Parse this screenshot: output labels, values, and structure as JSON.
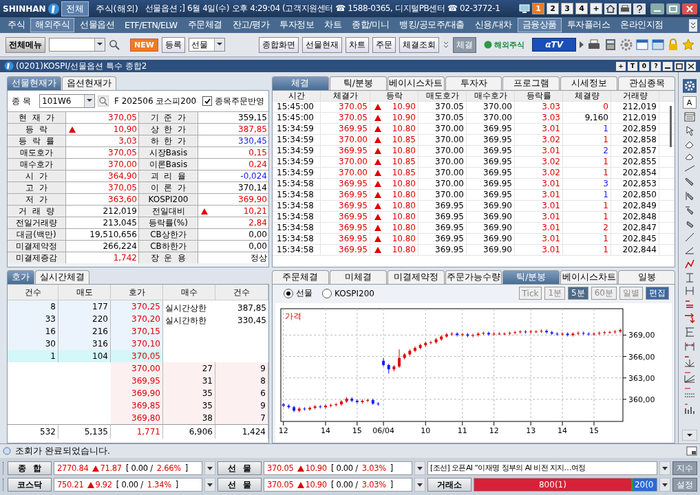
{
  "top_bar": {
    "logo": "SHINHAN",
    "tabs": [
      {
        "label": "전체",
        "selected": true
      },
      {
        "label": "주식(해외)",
        "selected": false
      }
    ],
    "info": "선물옵션 ;] 6월 4일(수) 오후 4:29:04 (고객지원센터 ☎ 1588-0365, 디지털PB센터 ☎ 02-3772-1",
    "screens": [
      {
        "label": "1",
        "selected": true
      },
      {
        "label": "2",
        "selected": false
      },
      {
        "label": "3",
        "selected": false
      },
      {
        "label": "4",
        "selected": false
      },
      {
        "label": "+",
        "selected": false
      }
    ]
  },
  "menu": [
    {
      "label": "주식",
      "selected": false
    },
    {
      "label": "해외주식",
      "selected": true
    },
    {
      "label": "선물옵션",
      "selected": false
    },
    {
      "label": "ETF/ETN/ELW",
      "selected": false
    },
    {
      "label": "주문체결",
      "selected": false
    },
    {
      "label": "잔고/평가",
      "selected": false
    },
    {
      "label": "투자정보",
      "selected": false
    },
    {
      "label": "차트",
      "selected": false
    },
    {
      "label": "종합/미니",
      "selected": false
    },
    {
      "label": "뱅킹/공모주/대출",
      "selected": false
    },
    {
      "label": "신용/대차",
      "selected": false
    },
    {
      "label": "금융상품",
      "selected": true
    },
    {
      "label": "투자플러스",
      "selected": false
    },
    {
      "label": "온라인지점",
      "selected": false
    }
  ],
  "toolbar": {
    "all_menu": "전체메뉴",
    "new_badge": "NEW",
    "register": "등록",
    "category": "선물",
    "screens": [
      "종합화면",
      "선물현재",
      "차트",
      "주문",
      "체결조회"
    ],
    "fill": "체결",
    "overseas": "해외주식",
    "tv": "αTV"
  },
  "window": {
    "title": "(0201)KOSPI/선물옵션 특수 종합2",
    "buttons": [
      "+",
      "T",
      "0",
      "?"
    ]
  },
  "quote": {
    "tabs": [
      {
        "label": "선물현재가",
        "selected": true
      },
      {
        "label": "옵션현재가",
        "selected": false
      }
    ],
    "symbol_label": "종 목",
    "code": "101W6",
    "name": "F 202506 코스피200",
    "order_link": {
      "label": "종목주문반영",
      "checked": true
    },
    "rows": [
      {
        "left": {
          "label": "현 재 가",
          "value": "370,05",
          "color": "#e00000",
          "arrow": false
        },
        "right": {
          "label": "기 준 가",
          "value": "359,15",
          "color": "#000000",
          "arrow": false
        }
      },
      {
        "left": {
          "label": "등 락",
          "value": "10,90",
          "color": "#e00000",
          "arrow": true
        },
        "right": {
          "label": "상 한 가",
          "value": "387,85",
          "color": "#e00000",
          "arrow": false
        }
      },
      {
        "left": {
          "label": "등 락 률",
          "value": "3,03",
          "color": "#e00000",
          "arrow": false
        },
        "right": {
          "label": "하 한 가",
          "value": "330,45",
          "color": "#1a1aff",
          "arrow": false
        }
      },
      {
        "left": {
          "label": "매도호가",
          "value": "370,05",
          "color": "#e00000",
          "arrow": false
        },
        "right": {
          "label": "시장Basis",
          "value": "0,15",
          "color": "#e00000",
          "arrow": false
        }
      },
      {
        "left": {
          "label": "매수호가",
          "value": "370,00",
          "color": "#e00000",
          "arrow": false
        },
        "right": {
          "label": "이론Basis",
          "value": "0,24",
          "color": "#e00000",
          "arrow": false
        }
      },
      {
        "left": {
          "label": "시 가",
          "value": "364,90",
          "color": "#e00000",
          "arrow": false
        },
        "right": {
          "label": "괴 리 율",
          "value": "-0,024",
          "color": "#1a1aff",
          "arrow": false
        }
      },
      {
        "left": {
          "label": "고 가",
          "value": "370,05",
          "color": "#e00000",
          "arrow": false
        },
        "right": {
          "label": "이 론 가",
          "value": "370,14",
          "color": "#000000",
          "arrow": false
        }
      },
      {
        "left": {
          "label": "저 가",
          "value": "363,60",
          "color": "#e00000",
          "arrow": false
        },
        "right": {
          "label": "KOSPI200",
          "value": "369,90",
          "color": "#e00000",
          "arrow": false
        }
      },
      {
        "left": {
          "label": "거 래 량",
          "value": "212,019",
          "color": "#000000",
          "arrow": false
        },
        "right": {
          "label": "전일대비",
          "value": "10,21",
          "color": "#e00000",
          "arrow": true
        }
      },
      {
        "left": {
          "label": "전일거래량",
          "value": "213,045",
          "color": "#000000",
          "arrow": false
        },
        "right": {
          "label": "등락률(%)",
          "value": "2,84",
          "color": "#e00000",
          "arrow": false
        }
      },
      {
        "left": {
          "label": "대금(백만)",
          "value": "19,510,656",
          "color": "#000000",
          "arrow": false
        },
        "right": {
          "label": "CB상한가",
          "value": "0,00",
          "color": "#000000",
          "arrow": false
        }
      },
      {
        "left": {
          "label": "미결제약정",
          "value": "266,224",
          "color": "#000000",
          "arrow": false
        },
        "right": {
          "label": "CB하한가",
          "value": "0,00",
          "color": "#000000",
          "arrow": false
        }
      },
      {
        "left": {
          "label": "미결제증감",
          "value": "1,742",
          "color": "#e00000",
          "arrow": false
        },
        "right": {
          "label": "장 운 용",
          "value": "정상",
          "arrow": false
        }
      }
    ]
  },
  "trades": {
    "tabs": [
      {
        "label": "체결",
        "selected": true
      },
      {
        "label": "틱/분봉",
        "selected": false
      },
      {
        "label": "베이시스차트",
        "selected": false
      },
      {
        "label": "투자자",
        "selected": false
      },
      {
        "label": "프로그램",
        "selected": false
      },
      {
        "label": "시세정보",
        "selected": false
      },
      {
        "label": "관심종목",
        "selected": false
      }
    ],
    "columns": [
      "시간",
      "체결가",
      "등락",
      "매도호가",
      "매수호가",
      "등락률",
      "체결량",
      "거래량"
    ],
    "rows": [
      {
        "time": "15:45:00",
        "price": "370.05",
        "change": "10.90",
        "ask": "370.05",
        "bid": "370.00",
        "rate": "3.03",
        "color": "#e00000",
        "qty": {
          "text": "0",
          "color": "#e00000"
        },
        "volume": "212,019"
      },
      {
        "time": "15:45:00",
        "price": "370.05",
        "change": "10.90",
        "ask": "370.05",
        "bid": "370.00",
        "rate": "3.03",
        "color": "#e00000",
        "qty": {
          "text": "9,160",
          "color": "#000000"
        },
        "volume": "212,019"
      },
      {
        "time": "15:34:59",
        "price": "369.95",
        "change": "10.80",
        "ask": "370.00",
        "bid": "369.95",
        "rate": "3.01",
        "color": "#e00000",
        "qty": {
          "text": "1",
          "color": "#1a1aff"
        },
        "volume": "202,859"
      },
      {
        "time": "15:34:59",
        "price": "370.00",
        "change": "10.85",
        "ask": "370.00",
        "bid": "369.95",
        "rate": "3.02",
        "color": "#e00000",
        "qty": {
          "text": "1",
          "color": "#e00000"
        },
        "volume": "202,858"
      },
      {
        "time": "15:34:59",
        "price": "369.95",
        "change": "10.80",
        "ask": "370.00",
        "bid": "369.95",
        "rate": "3.01",
        "color": "#e00000",
        "qty": {
          "text": "2",
          "color": "#1a1aff"
        },
        "volume": "202,857"
      },
      {
        "time": "15:34:59",
        "price": "370.00",
        "change": "10.85",
        "ask": "370.00",
        "bid": "369.95",
        "rate": "3.02",
        "color": "#e00000",
        "qty": {
          "text": "1",
          "color": "#e00000"
        },
        "volume": "202,855"
      },
      {
        "time": "15:34:59",
        "price": "370.00",
        "change": "10.85",
        "ask": "370.00",
        "bid": "369.95",
        "rate": "3.02",
        "color": "#e00000",
        "qty": {
          "text": "1",
          "color": "#e00000"
        },
        "volume": "202,854"
      },
      {
        "time": "15:34:58",
        "price": "369.95",
        "change": "10.80",
        "ask": "370.00",
        "bid": "369.95",
        "rate": "3.01",
        "color": "#e00000",
        "qty": {
          "text": "3",
          "color": "#1a1aff"
        },
        "volume": "202,853"
      },
      {
        "time": "15:34:58",
        "price": "369.95",
        "change": "10.80",
        "ask": "370.00",
        "bid": "369.95",
        "rate": "3.01",
        "color": "#e00000",
        "qty": {
          "text": "1",
          "color": "#1a1aff"
        },
        "volume": "202,850"
      },
      {
        "time": "15:34:58",
        "price": "369.95",
        "change": "10.80",
        "ask": "369.95",
        "bid": "369.90",
        "rate": "3.01",
        "color": "#e00000",
        "qty": {
          "text": "1",
          "color": "#e00000"
        },
        "volume": "202,849"
      },
      {
        "time": "15:34:58",
        "price": "369.95",
        "change": "10.80",
        "ask": "369.95",
        "bid": "369.90",
        "rate": "3.01",
        "color": "#e00000",
        "qty": {
          "text": "1",
          "color": "#e00000"
        },
        "volume": "202,848"
      },
      {
        "time": "15:34:58",
        "price": "369.95",
        "change": "10.80",
        "ask": "369.95",
        "bid": "369.90",
        "rate": "3.01",
        "color": "#e00000",
        "qty": {
          "text": "2",
          "color": "#e00000"
        },
        "volume": "202,847"
      },
      {
        "time": "15:34:58",
        "price": "369.95",
        "change": "10.80",
        "ask": "369.95",
        "bid": "369.90",
        "rate": "3.01",
        "color": "#e00000",
        "qty": {
          "text": "1",
          "color": "#e00000"
        },
        "volume": "202,845"
      },
      {
        "time": "15:34:58",
        "price": "369.95",
        "change": "10.80",
        "ask": "369.95",
        "bid": "369.90",
        "rate": "3.01",
        "color": "#e00000",
        "qty": {
          "text": "1",
          "color": "#e00000"
        },
        "volume": "202,844"
      }
    ]
  },
  "side_tools": {
    "font_button": "A"
  },
  "orderbook": {
    "tabs": [
      {
        "label": "호가",
        "selected": true
      },
      {
        "label": "실시간체결",
        "selected": false
      }
    ],
    "columns": [
      "건수",
      "매도",
      "호가",
      "매수",
      "건수"
    ],
    "asks": [
      {
        "count": "8",
        "qty": "177",
        "price": "370,25",
        "best": false
      },
      {
        "count": "33",
        "qty": "220",
        "price": "370,20",
        "best": false
      },
      {
        "count": "16",
        "qty": "216",
        "price": "370,15",
        "best": false
      },
      {
        "count": "30",
        "qty": "316",
        "price": "370,10",
        "best": false
      },
      {
        "count": "1",
        "qty": "104",
        "price": "370,05",
        "best": true
      }
    ],
    "limits": [
      {
        "label": "실시간상한",
        "value": "387,85"
      },
      {
        "label": "실시간하한",
        "value": "330,45"
      }
    ],
    "bids": [
      {
        "price": "370,00",
        "qty": "27",
        "count": "9"
      },
      {
        "price": "369,95",
        "qty": "31",
        "count": "8"
      },
      {
        "price": "369,90",
        "qty": "35",
        "count": "6"
      },
      {
        "price": "369,85",
        "qty": "35",
        "count": "9"
      },
      {
        "price": "369,80",
        "qty": "38",
        "count": "7"
      }
    ],
    "totals": [
      "532",
      "5,135",
      "1,771",
      "6,906",
      "1,424"
    ]
  },
  "orders": {
    "tabs": [
      {
        "label": "주문체결",
        "selected": false
      },
      {
        "label": "미체결",
        "selected": false
      },
      {
        "label": "미결제약정",
        "selected": false
      },
      {
        "label": "주문가능수량",
        "selected": false
      },
      {
        "label": "틱/분봉",
        "selected": true
      },
      {
        "label": "베이시스차트",
        "selected": false
      },
      {
        "label": "일봉",
        "selected": false
      }
    ],
    "radios": [
      {
        "label": "선물",
        "selected": true
      },
      {
        "label": "KOSPI200",
        "selected": false
      }
    ],
    "periods": [
      {
        "label": "Tick",
        "selected": false,
        "disabled": true
      },
      {
        "label": "1분",
        "selected": false,
        "disabled": true
      },
      {
        "label": "5분",
        "selected": true,
        "disabled": false
      },
      {
        "label": "60분",
        "selected": false,
        "disabled": true
      },
      {
        "label": "일별",
        "selected": false,
        "disabled": true
      }
    ],
    "edit": "편집",
    "chart_data": {
      "type": "candlestick",
      "title": "가격",
      "grid": true,
      "ylim": [
        356.9,
        372.7
      ],
      "yticks": [
        {
          "value": 360,
          "label": "360,00"
        },
        {
          "value": 363,
          "label": "363,00"
        },
        {
          "value": 366,
          "label": "366,00"
        },
        {
          "value": 369,
          "label": "369,00"
        }
      ],
      "categories": [
        "12",
        null,
        null,
        null,
        null,
        null,
        null,
        null,
        "14",
        null,
        null,
        null,
        null,
        null,
        "15",
        null,
        null,
        null,
        null,
        "06/04",
        null,
        null,
        null,
        null,
        null,
        null,
        null,
        "10",
        null,
        null,
        null,
        null,
        null,
        null,
        "11",
        null,
        null,
        null,
        null,
        null,
        "12",
        null,
        null,
        null,
        null,
        null,
        null,
        "13",
        null,
        null,
        null,
        null,
        null,
        "14",
        null,
        null,
        null,
        null,
        null,
        "15",
        null,
        null,
        null,
        null,
        null
      ],
      "ohlc": [
        [
          359.3,
          359.5,
          358.9,
          359.1
        ],
        [
          359.1,
          359.3,
          358.7,
          358.9
        ],
        [
          358.9,
          359.1,
          358.2,
          358.4
        ],
        [
          358.4,
          358.9,
          358.2,
          358.7
        ],
        [
          358.7,
          358.9,
          358.4,
          358.6
        ],
        [
          358.6,
          359.0,
          358.4,
          358.8
        ],
        [
          358.8,
          359.2,
          358.6,
          359.0
        ],
        [
          359.0,
          359.2,
          358.7,
          358.9
        ],
        [
          358.9,
          359.3,
          358.7,
          359.1
        ],
        [
          359.1,
          359.4,
          358.9,
          359.2
        ],
        [
          359.2,
          359.5,
          359.0,
          359.3
        ],
        [
          359.3,
          359.9,
          359.1,
          359.7
        ],
        [
          359.7,
          360.3,
          359.5,
          360.1
        ],
        [
          360.1,
          360.3,
          359.6,
          359.8
        ],
        [
          359.8,
          360.0,
          359.4,
          359.6
        ],
        [
          359.6,
          360.0,
          359.4,
          359.8
        ],
        [
          359.8,
          360.1,
          359.6,
          359.9
        ],
        [
          359.9,
          360.1,
          359.2,
          359.4
        ],
        [
          359.4,
          359.6,
          359.1,
          359.3
        ],
        [
          365.4,
          365.8,
          364.6,
          364.8
        ],
        [
          364.8,
          365.0,
          363.6,
          364.2
        ],
        [
          364.2,
          364.8,
          363.9,
          364.6
        ],
        [
          364.6,
          367.0,
          364.4,
          365.8
        ],
        [
          365.8,
          366.5,
          365.6,
          366.3
        ],
        [
          366.3,
          367.0,
          366.1,
          366.8
        ],
        [
          366.8,
          367.4,
          366.6,
          367.2
        ],
        [
          367.2,
          367.8,
          367.0,
          367.6
        ],
        [
          367.6,
          368.1,
          367.4,
          367.9
        ],
        [
          367.9,
          368.2,
          367.7,
          368.0
        ],
        [
          368.0,
          368.6,
          367.8,
          368.4
        ],
        [
          368.4,
          369.0,
          368.2,
          368.8
        ],
        [
          368.8,
          369.3,
          368.6,
          369.1
        ],
        [
          369.1,
          369.4,
          368.9,
          369.2
        ],
        [
          369.2,
          369.4,
          368.8,
          369.0
        ],
        [
          369.0,
          369.3,
          368.8,
          369.1
        ],
        [
          369.1,
          369.3,
          368.7,
          368.9
        ],
        [
          368.9,
          369.2,
          368.7,
          369.0
        ],
        [
          369.0,
          369.4,
          368.8,
          369.2
        ],
        [
          369.2,
          369.5,
          369.0,
          369.3
        ],
        [
          369.3,
          369.5,
          368.9,
          369.1
        ],
        [
          369.1,
          369.4,
          368.9,
          369.2
        ],
        [
          369.2,
          369.4,
          369.0,
          369.2
        ],
        [
          369.2,
          369.4,
          369.0,
          369.2
        ],
        [
          369.2,
          369.5,
          369.0,
          369.3
        ],
        [
          369.3,
          369.6,
          369.1,
          369.4
        ],
        [
          369.4,
          369.7,
          369.2,
          369.5
        ],
        [
          369.5,
          369.7,
          369.2,
          369.4
        ],
        [
          369.4,
          369.7,
          369.2,
          369.5
        ],
        [
          369.5,
          369.7,
          369.3,
          369.5
        ],
        [
          369.5,
          369.8,
          369.3,
          369.6
        ],
        [
          369.6,
          369.8,
          369.2,
          369.4
        ],
        [
          369.4,
          369.6,
          369.0,
          369.2
        ],
        [
          369.2,
          369.4,
          368.9,
          369.1
        ],
        [
          369.1,
          369.4,
          368.9,
          369.2
        ],
        [
          369.2,
          369.4,
          368.8,
          369.0
        ],
        [
          369.0,
          369.4,
          368.8,
          369.2
        ],
        [
          369.2,
          369.5,
          369.0,
          369.3
        ],
        [
          369.3,
          369.5,
          369.0,
          369.2
        ],
        [
          369.2,
          369.4,
          368.9,
          369.1
        ],
        [
          369.1,
          369.4,
          368.9,
          369.2
        ],
        [
          369.2,
          369.5,
          369.0,
          369.3
        ],
        [
          369.3,
          369.6,
          369.1,
          369.4
        ],
        [
          369.4,
          369.6,
          369.2,
          369.4
        ],
        [
          369.4,
          369.7,
          369.2,
          369.5
        ],
        [
          369.5,
          369.9,
          369.3,
          369.7
        ]
      ]
    }
  },
  "status": "조회가 완료되었습니다.",
  "ticker": {
    "rows": [
      {
        "index": {
          "label": "종 합",
          "value": "2770.84",
          "color": "#e00000",
          "arrow": true,
          "change": "71.87",
          "bracket": "[ 0.00 /",
          "rate": "2.66%",
          "close": "]"
        },
        "futures": {
          "label": "선 물",
          "value": "370.05",
          "color": "#e00000",
          "arrow": true,
          "change": "10.90",
          "bracket": "[ 0.00 /",
          "rate": "3.03%",
          "close": "]"
        },
        "kind": "news",
        "news": "[조선] 오픈AI “이재명 정부의 AI 비전 지지…여정",
        "button": "지수"
      },
      {
        "index": {
          "label": "코스닥",
          "value": "750.21",
          "color": "#e00000",
          "arrow": true,
          "change": "9.92",
          "bracket": "[ 0.00 /",
          "rate": "1.34%",
          "close": "]"
        },
        "futures": {
          "label": "선 물",
          "value": "370.05",
          "color": "#e00000",
          "arrow": true,
          "change": "10.90",
          "bracket": "[ 0.00 /",
          "rate": "3.03%",
          "close": "]"
        },
        "kind": "breadth",
        "market": "거래소",
        "breadth": {
          "up": "800(1)",
          "down": "20(0",
          "level": 0.86
        },
        "button": "설정"
      }
    ]
  }
}
